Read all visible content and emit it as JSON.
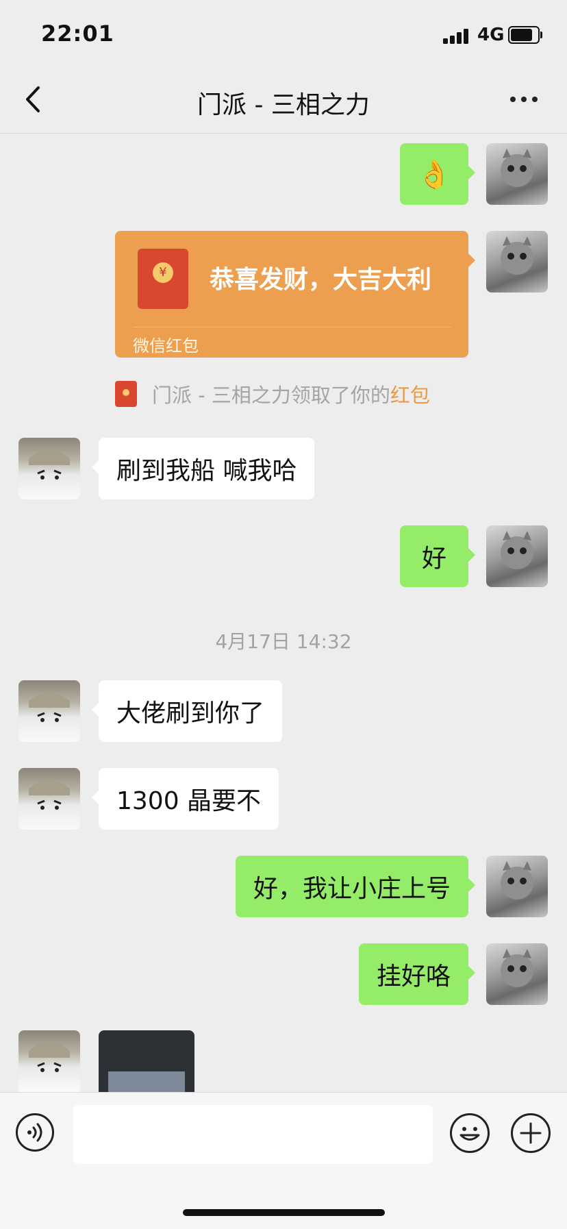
{
  "status_bar": {
    "time": "22:01",
    "network": "4G"
  },
  "nav": {
    "title": "门派 - 三相之力"
  },
  "messages": [
    {
      "kind": "emoji",
      "side": "out",
      "emoji": "👌"
    },
    {
      "kind": "red_packet",
      "side": "out",
      "greeting": "恭喜发财，大吉大利",
      "label": "微信红包"
    },
    {
      "kind": "notice",
      "text": "门派 - 三相之力领取了你的",
      "link": "红包"
    },
    {
      "kind": "text",
      "side": "in",
      "text": "刷到我船 喊我哈"
    },
    {
      "kind": "text",
      "side": "out",
      "text": "好"
    },
    {
      "kind": "timestamp",
      "text": "4月17日 14:32"
    },
    {
      "kind": "text",
      "side": "in",
      "text": "大佬刷到你了"
    },
    {
      "kind": "text",
      "side": "in",
      "text": "1300 晶要不"
    },
    {
      "kind": "text",
      "side": "out",
      "text": "好，我让小庄上号"
    },
    {
      "kind": "text",
      "side": "out",
      "text": "挂好咯"
    },
    {
      "kind": "image",
      "side": "in"
    }
  ],
  "colors": {
    "outgoing_bubble": "#95ec69",
    "incoming_bubble": "#ffffff",
    "red_packet": "#eca04f",
    "link": "#e99a45",
    "background": "#ededed"
  },
  "icons": {
    "back": "chevron-left-icon",
    "more": "more-dots-icon",
    "voice": "voice-icon",
    "emoji": "smiley-icon",
    "plus": "plus-icon"
  }
}
